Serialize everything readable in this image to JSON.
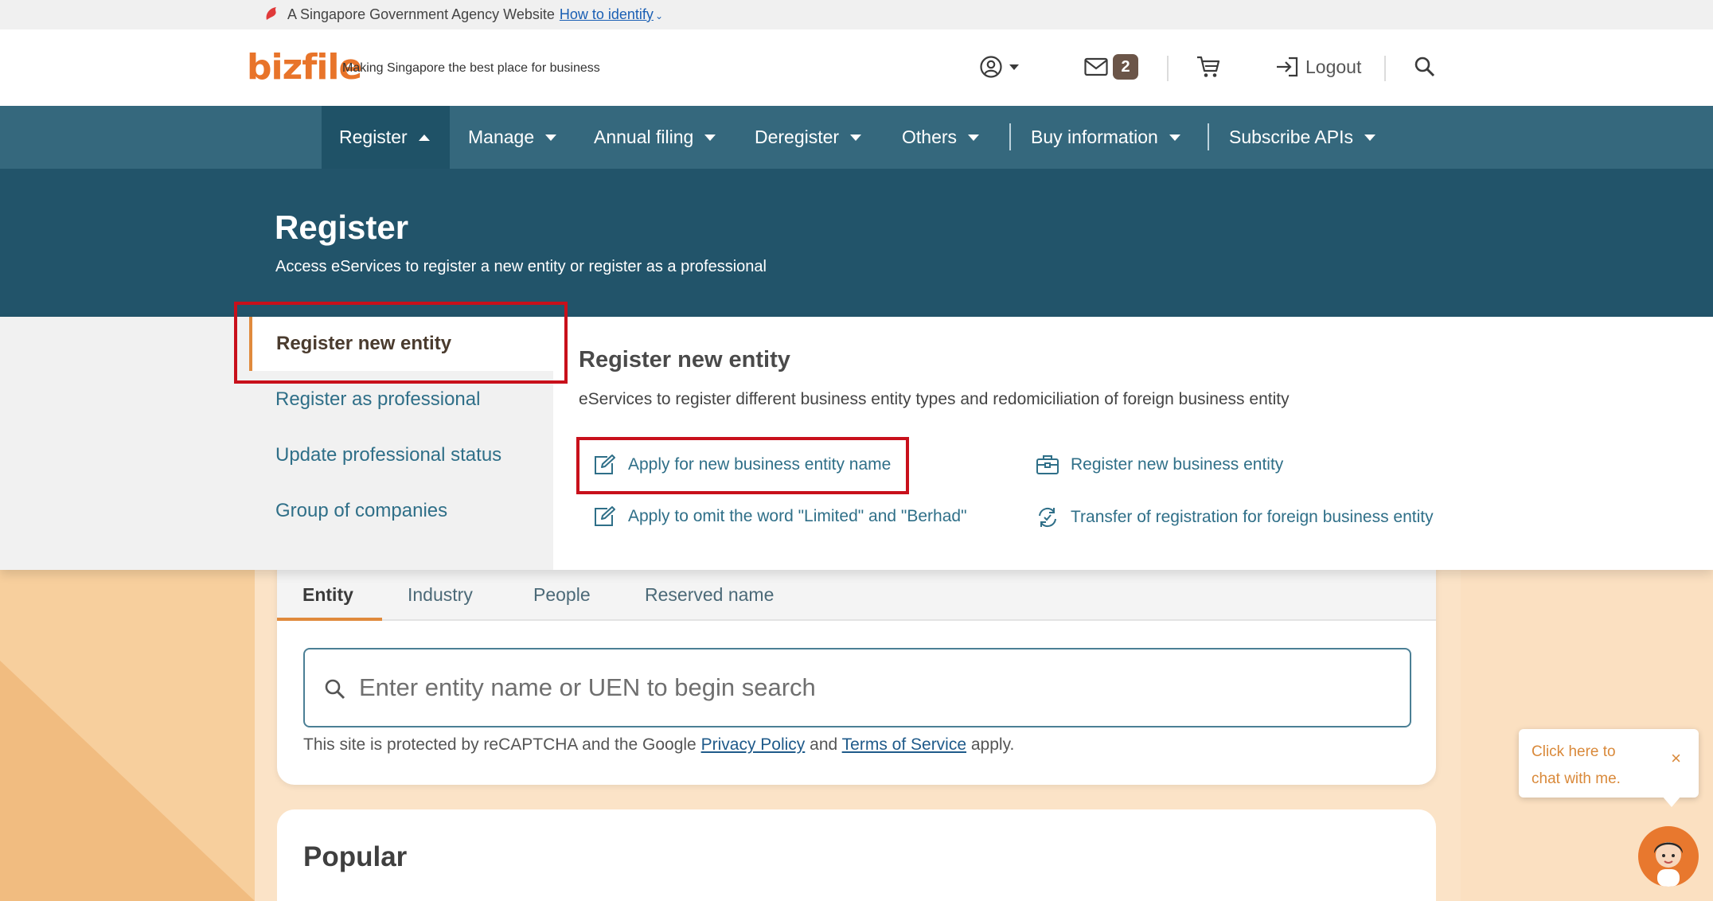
{
  "gov_banner": {
    "text": "A Singapore Government Agency Website",
    "link": "How to identify"
  },
  "header": {
    "logo": "bizfile",
    "tagline": "Making Singapore the best place for business",
    "mail_count": "2",
    "logout_label": "Logout",
    "icons": [
      "user-circle-icon",
      "mail-icon",
      "cart-icon",
      "logout-icon",
      "search-icon"
    ]
  },
  "nav": {
    "items": [
      "Register",
      "Manage",
      "Annual filing",
      "Deregister",
      "Others",
      "Buy information",
      "Subscribe APIs"
    ]
  },
  "register": {
    "title": "Register",
    "subtitle": "Access eServices to register a new entity or register as a professional",
    "sidebar": [
      "Register new entity",
      "Register as professional",
      "Update professional status",
      "Group of companies"
    ],
    "content_title": "Register new entity",
    "content_desc": "eServices to register different business entity types and redomiciliation of foreign business entity",
    "links": [
      "Apply for new business entity name",
      "Register new business entity",
      "Apply to omit the word \"Limited\" and \"Berhad\"",
      "Transfer of registration for foreign business entity"
    ]
  },
  "search_card": {
    "tabs": [
      "Entity",
      "Industry",
      "People",
      "Reserved name"
    ],
    "placeholder": "Enter entity name or UEN to begin search",
    "recaptcha_pre": "This site is protected by reCAPTCHA and the Google",
    "privacy": "Privacy Policy",
    "and": "and",
    "terms": "Terms of Service",
    "apply": "apply."
  },
  "popular_title": "Popular",
  "chat": {
    "line1": "Click here to",
    "line2": "chat with me.",
    "close": "×"
  },
  "colors": {
    "nav": "#35687d",
    "banner": "#22546a",
    "accent": "#e08a3c",
    "annotation": "#c8101b"
  }
}
